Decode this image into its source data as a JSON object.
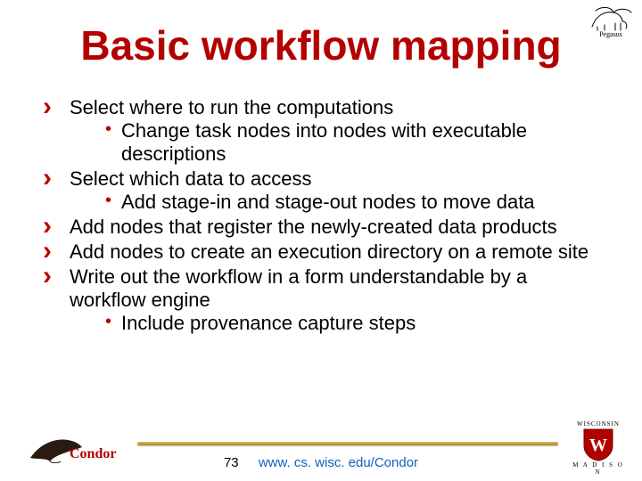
{
  "title": "Basic workflow mapping",
  "pegasus_caption": "Pegasus",
  "bullets": [
    {
      "text": "Select where to run the computations",
      "sub": [
        "Change task nodes into nodes with executable descriptions"
      ]
    },
    {
      "text": "Select which data to access",
      "sub": [
        "Add stage-in and stage-out nodes to move data"
      ]
    },
    {
      "text": "Add nodes that register the newly-created data products",
      "sub": []
    },
    {
      "text": "Add nodes to create an execution directory on a remote site",
      "sub": []
    },
    {
      "text": "Write out the workflow in a form understandable by a workflow engine",
      "sub": [
        "Include provenance capture steps"
      ]
    }
  ],
  "footer": {
    "page_number": "73",
    "url": "www. cs. wisc. edu/Condor",
    "condor_label": "Condor",
    "uw_label_top": "WISCONSIN",
    "uw_label_bottom": "M A D I S O N"
  }
}
